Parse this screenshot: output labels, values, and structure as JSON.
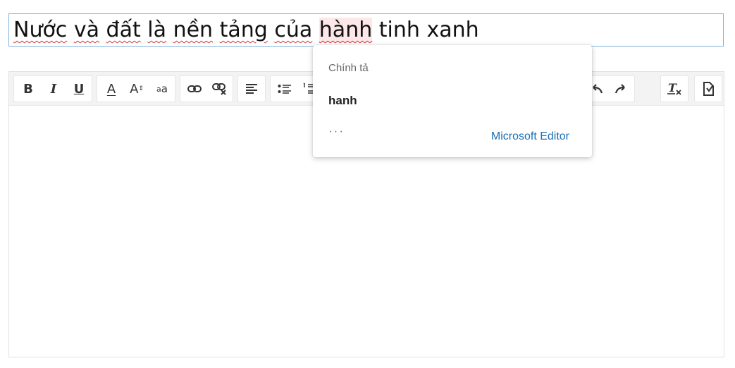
{
  "title_input": {
    "words": [
      "Nước",
      "và",
      "đất",
      "là",
      "nền",
      "tảng",
      "của",
      "hành",
      "tinh",
      "xanh"
    ]
  },
  "toolbar": {
    "bold": "B",
    "italic": "I",
    "underline": "U",
    "font_color": "A",
    "font_size": "A",
    "subscript": "a"
  },
  "spell_popup": {
    "category": "Chính tả",
    "suggestion": "hanh",
    "more": "···",
    "brand": "Microsoft Editor"
  },
  "colors": {
    "accent": "#1a6fb5",
    "squiggle": "#d13438",
    "highlight": "#fde7e9"
  }
}
